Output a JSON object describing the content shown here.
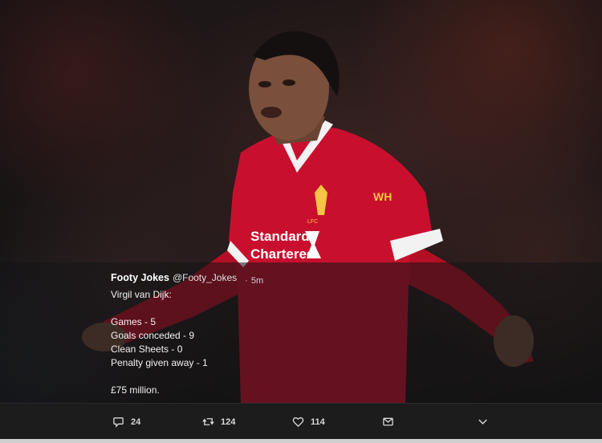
{
  "tweet": {
    "author": "Footy Jokes",
    "handle": "@Footy_Jokes",
    "separator": "·",
    "time": "5m",
    "lines": [
      "Virgil van Dijk:",
      "",
      "Games - 5",
      "Goals conceded - 9",
      "Clean Sheets - 0",
      "Penalty given away - 1",
      "",
      "£75 million."
    ]
  },
  "photo": {
    "sponsor_line1": "Standard",
    "sponsor_line2": "Chartered",
    "club_badge": "LFC",
    "kit_colors": {
      "shirt": "#c8102e",
      "trim": "#ffffff",
      "crest": "#f6c543"
    }
  },
  "actions": {
    "reply_count": "24",
    "retweet_count": "124",
    "like_count": "114",
    "icons": [
      "reply-icon",
      "retweet-icon",
      "like-icon",
      "message-icon",
      "chevron-down-icon"
    ]
  }
}
